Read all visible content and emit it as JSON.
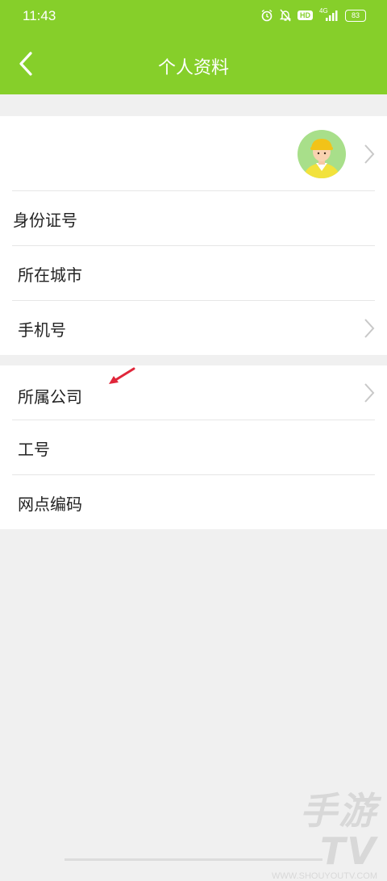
{
  "status_bar": {
    "time": "11:43",
    "battery": "83",
    "network": "4G",
    "hd": "HD"
  },
  "header": {
    "title": "个人资料",
    "accent": "#86cf2a"
  },
  "profile": {
    "avatar_icon": "courier-avatar-icon"
  },
  "section1": [
    {
      "label": "身份证号",
      "chevron": false
    },
    {
      "label": "所在城市",
      "chevron": false
    },
    {
      "label": "手机号",
      "chevron": true
    }
  ],
  "section2": [
    {
      "label": "所属公司",
      "chevron": true
    },
    {
      "label": "工号",
      "chevron": false
    },
    {
      "label": "网点编码",
      "chevron": false
    }
  ],
  "watermark": {
    "big": "手游TV",
    "small": "WWW.SHOUYOUTV.COM"
  }
}
